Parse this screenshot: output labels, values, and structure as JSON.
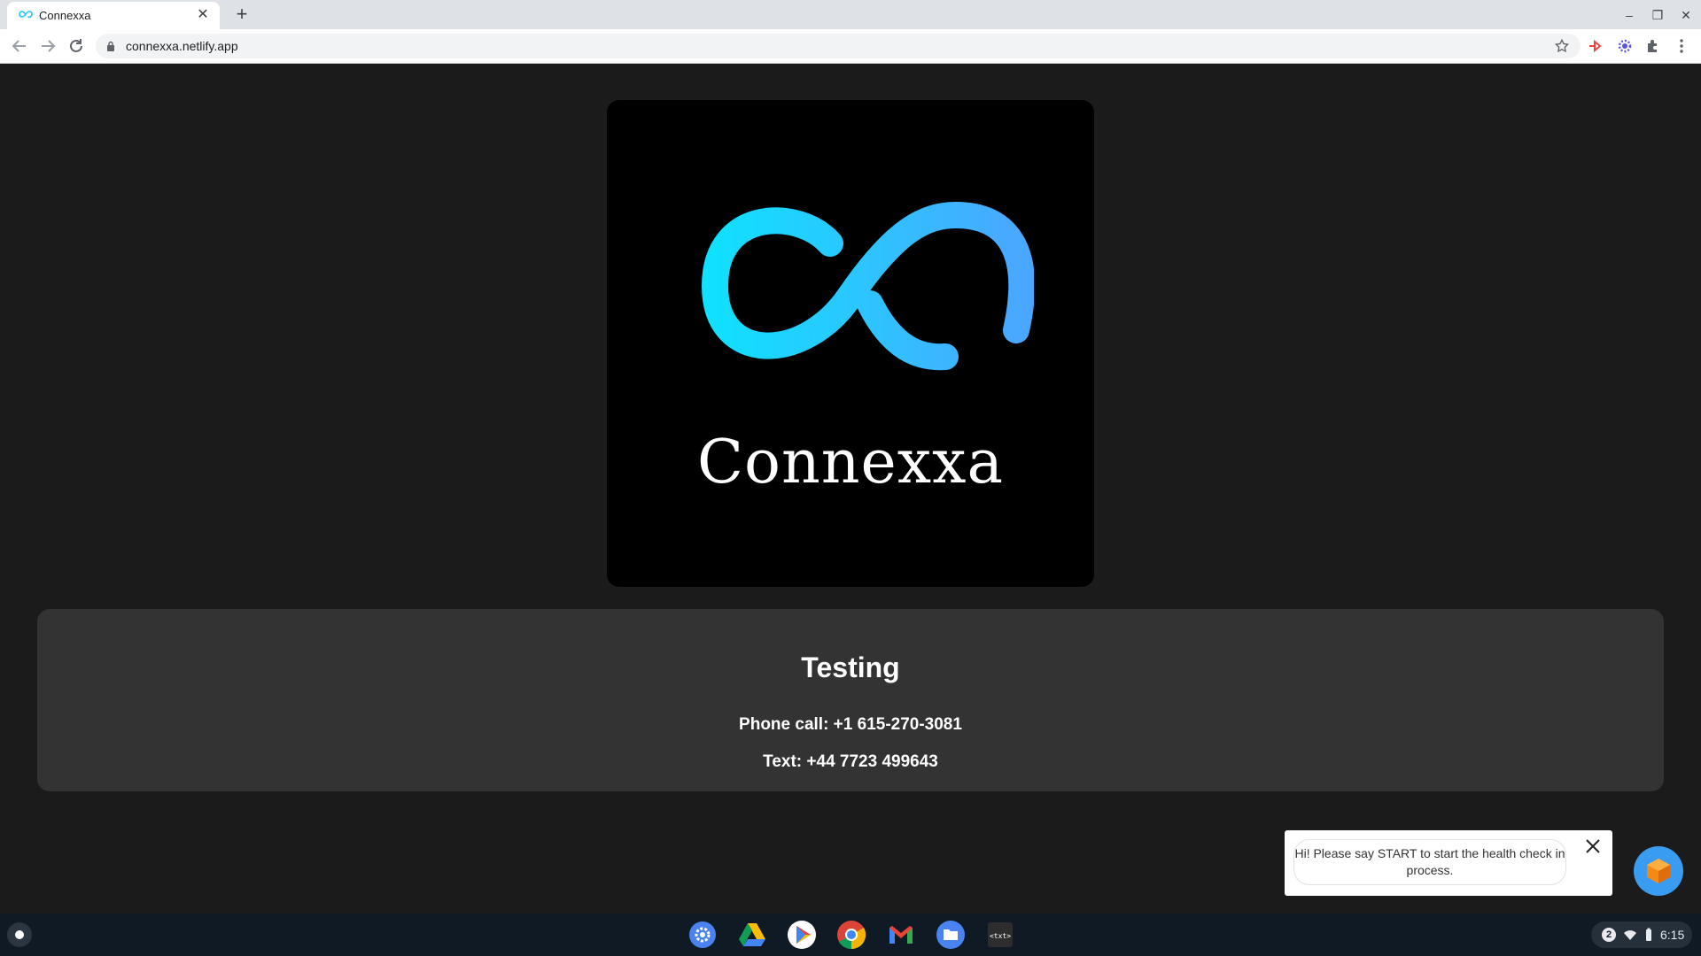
{
  "browser": {
    "tab_title": "Connexxa",
    "url": "connexxa.netlify.app"
  },
  "logo": {
    "brand_name": "Connexxa",
    "gradient_start": "#11e0ff",
    "gradient_end": "#4aa7ff"
  },
  "info": {
    "heading": "Testing",
    "phone_line": "Phone call: +1 615-270-3081",
    "text_line": "Text: +44 7723 499643"
  },
  "chat": {
    "message": "Hi! Please say START to start the health check in process."
  },
  "shelf": {
    "apps": [
      "settings-icon",
      "google-drive-icon",
      "play-store-icon",
      "chrome-icon",
      "gmail-icon",
      "files-icon",
      "text-editor-icon"
    ],
    "notification_count": "2",
    "time": "6:15"
  }
}
